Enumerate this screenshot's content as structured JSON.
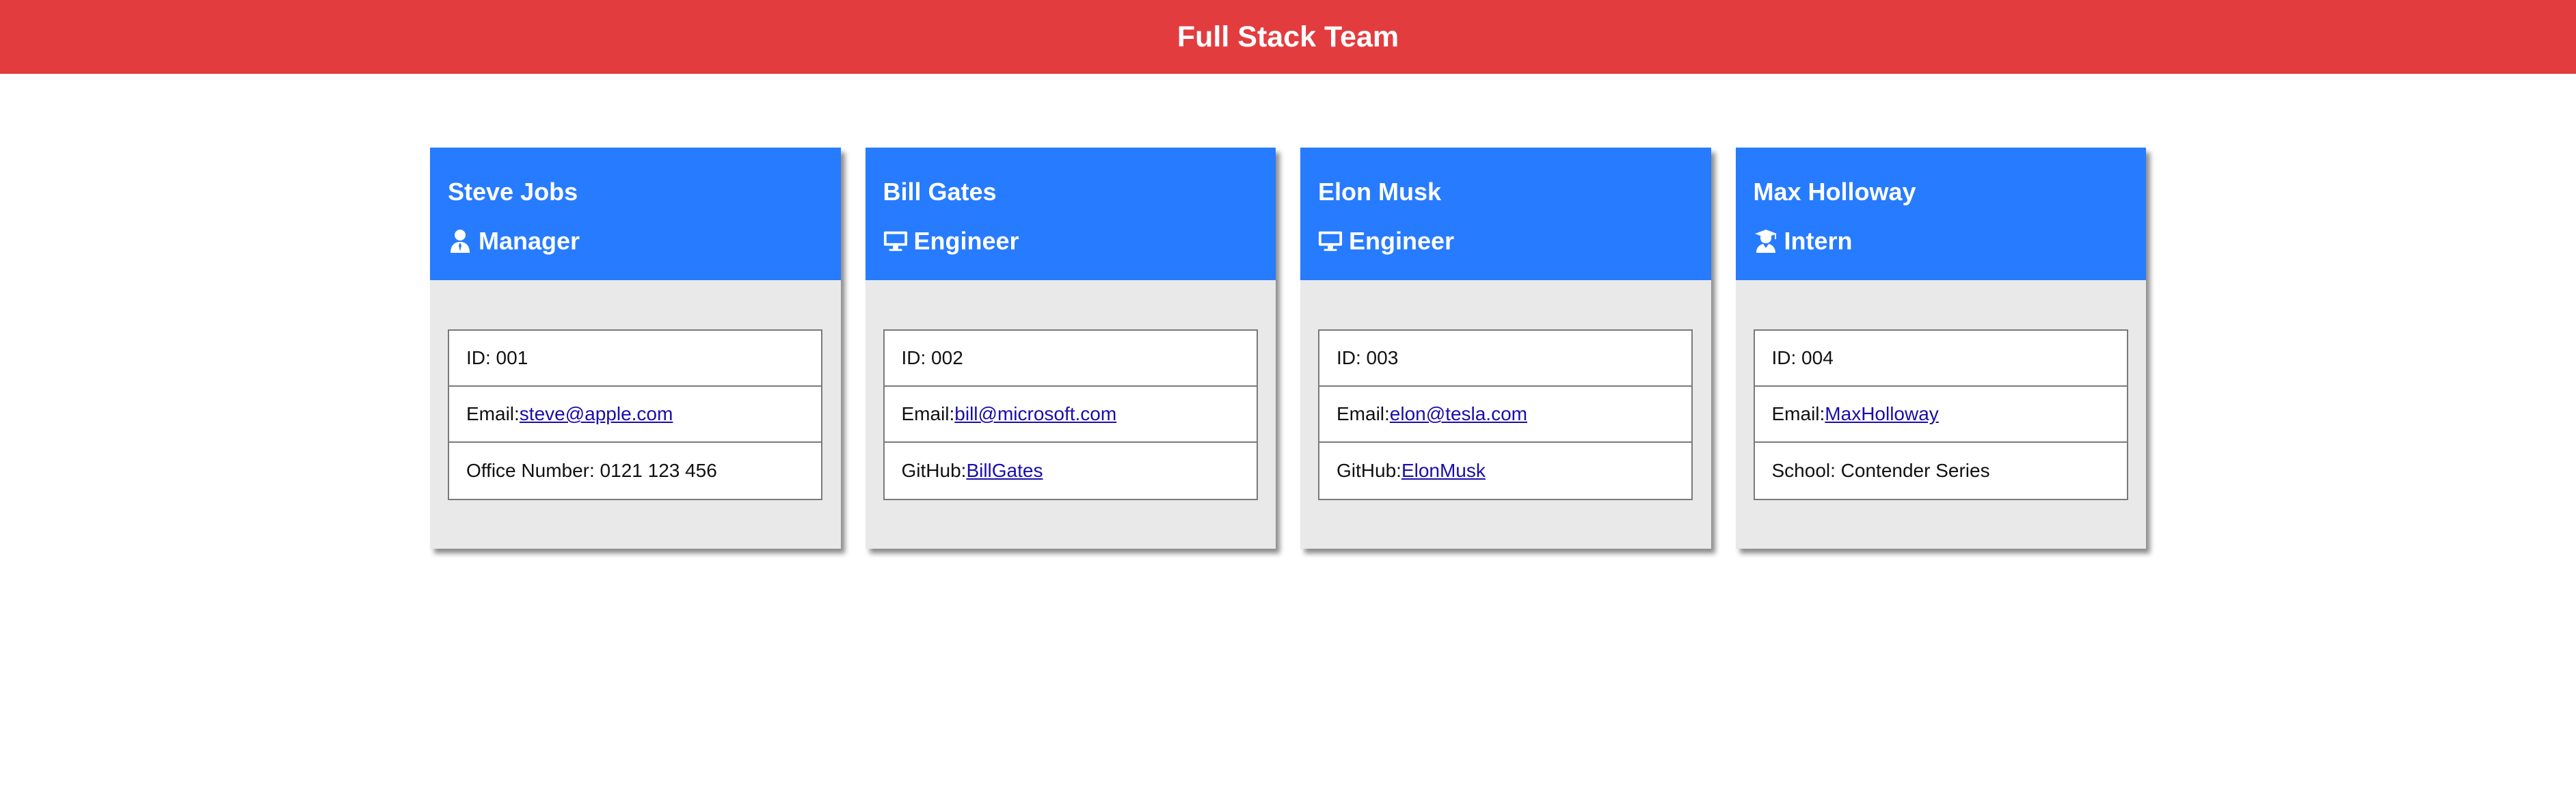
{
  "header": {
    "title": "Full Stack Team"
  },
  "colors": {
    "header_bg": "#e33c3f",
    "card_header_bg": "#277bff",
    "card_body_bg": "#e9e9e9",
    "link": "#1a0dab"
  },
  "cards": [
    {
      "name": "Steve Jobs",
      "role": "Manager",
      "role_icon": "user-icon",
      "id_label": "ID: 001",
      "email_prefix": "Email:",
      "email": "steve@apple.com",
      "extra_label": "Office Number: 0121 123 456"
    },
    {
      "name": "Bill Gates",
      "role": "Engineer",
      "role_icon": "desktop-icon",
      "id_label": "ID: 002",
      "email_prefix": "Email:",
      "email": "bill@microsoft.com",
      "extra_prefix": "GitHub:",
      "extra_link": "BillGates"
    },
    {
      "name": "Elon Musk",
      "role": "Engineer",
      "role_icon": "desktop-icon",
      "id_label": "ID: 003",
      "email_prefix": "Email:",
      "email": "elon@tesla.com",
      "extra_prefix": "GitHub:",
      "extra_link": "ElonMusk"
    },
    {
      "name": "Max Holloway",
      "role": "Intern",
      "role_icon": "graduate-icon",
      "id_label": "ID: 004",
      "email_prefix": "Email:",
      "email": "MaxHolloway",
      "extra_label": "School: Contender Series"
    }
  ]
}
